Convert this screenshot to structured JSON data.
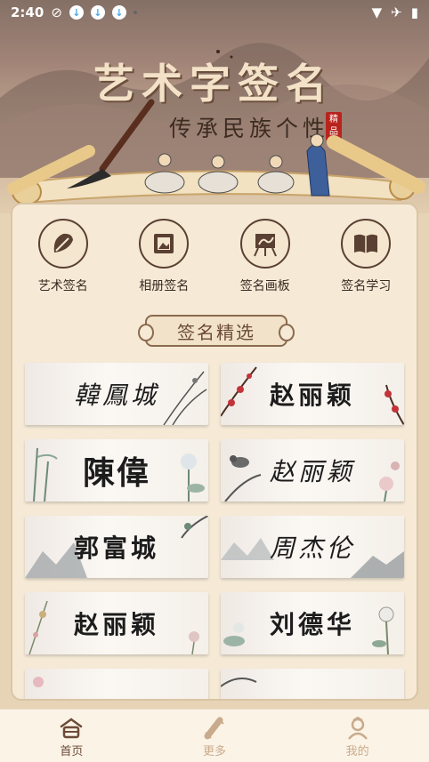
{
  "status": {
    "time": "2:40"
  },
  "banner": {
    "title": "艺术字签名",
    "subtitle": "传承民族个性",
    "seal": "精品"
  },
  "features": [
    {
      "label": "艺术签名",
      "icon": "leaf-icon"
    },
    {
      "label": "相册签名",
      "icon": "photo-icon"
    },
    {
      "label": "签名画板",
      "icon": "easel-icon"
    },
    {
      "label": "签名学习",
      "icon": "book-icon"
    }
  ],
  "section": {
    "title": "签名精选"
  },
  "signatures": [
    {
      "text": "韓鳳城"
    },
    {
      "text": "赵丽颖"
    },
    {
      "text": "陳偉"
    },
    {
      "text": "赵丽颖"
    },
    {
      "text": "郭富城"
    },
    {
      "text": "周杰伦"
    },
    {
      "text": "赵丽颖"
    },
    {
      "text": "刘德华"
    }
  ],
  "nav": [
    {
      "label": "首页",
      "active": true
    },
    {
      "label": "更多",
      "active": false
    },
    {
      "label": "我的",
      "active": false
    }
  ],
  "colors": {
    "accent": "#6b4b38",
    "panel": "#f6ead7",
    "inactive": "#c9ab8c"
  }
}
